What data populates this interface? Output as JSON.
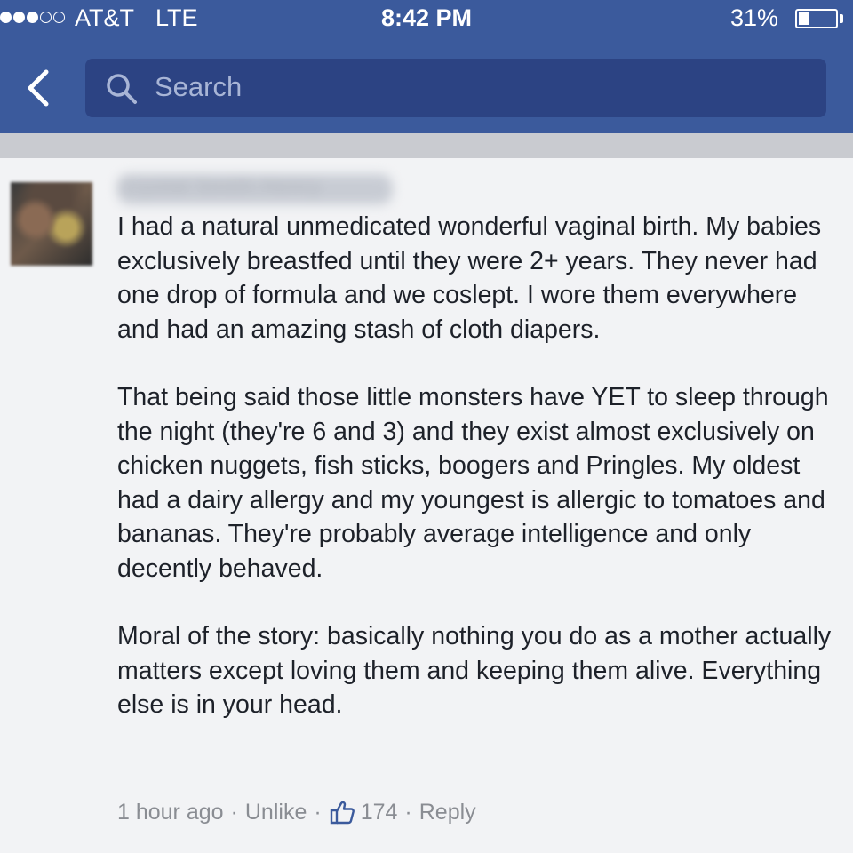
{
  "status_bar": {
    "carrier": "AT&T",
    "network": "LTE",
    "time": "8:42 PM",
    "battery_percent": "31%",
    "battery_level": 0.31,
    "signal_strength": 3,
    "signal_max": 5
  },
  "nav": {
    "back_icon": "chevron-left-icon",
    "search_placeholder": "Search",
    "search_icon": "magnifier-icon"
  },
  "comment": {
    "author": "Crystal Smith Henry",
    "paragraphs": [
      "I had a natural unmedicated wonderful vaginal birth. My babies exclusively breastfed until they were 2+ years. They never had one drop of formula and we coslept. I wore them everywhere and had an amazing stash of cloth diapers.",
      "That being said those little monsters have YET to sleep through the night (they're 6 and 3) and they exist almost exclusively on chicken nuggets, fish sticks, boogers and Pringles. My oldest had a dairy allergy and my youngest is allergic to tomatoes and bananas. They're probably average intelligence and only decently behaved.",
      "Moral of the story: basically nothing you do as a mother actually matters except loving them and keeping them alive. Everything else is in your head."
    ],
    "timestamp": "1 hour ago",
    "unlike_label": "Unlike",
    "like_count": "174",
    "reply_label": "Reply",
    "separator": "·"
  },
  "colors": {
    "header_blue": "#3b5a9c",
    "search_field": "#2c4383",
    "text": "#1d2129",
    "meta_text": "#8a8d93"
  }
}
